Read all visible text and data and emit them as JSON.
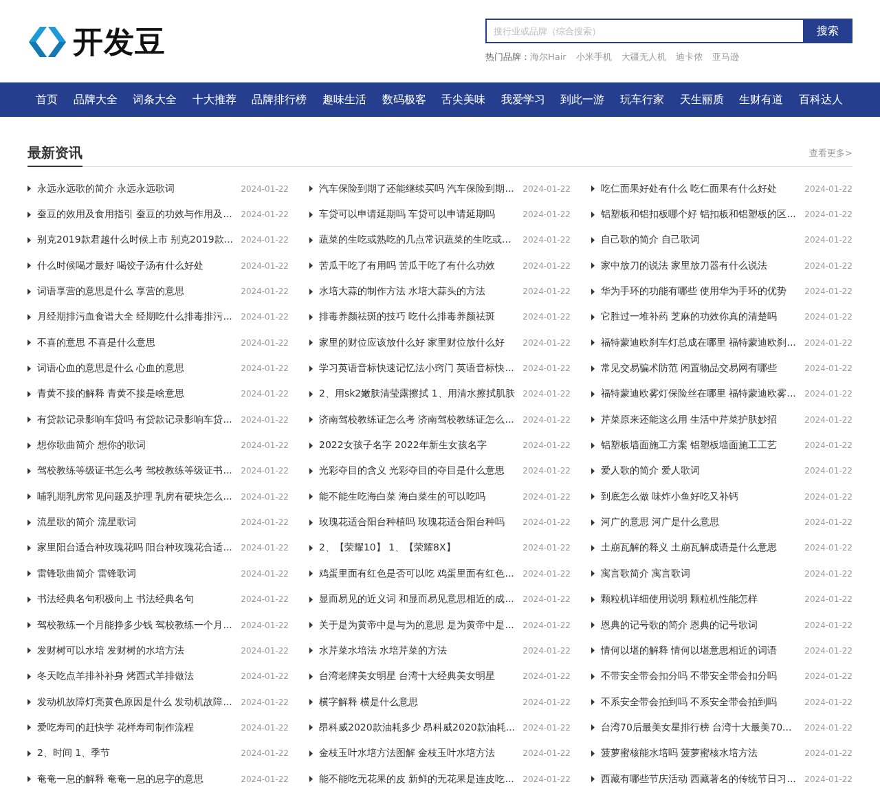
{
  "header": {
    "logo_text": "开发豆",
    "search": {
      "placeholder": "搜行业或品牌（综合搜索）",
      "button": "搜索"
    },
    "hot_label": "热门品牌：",
    "hot_brands": [
      "海尔Hair",
      "小米手机",
      "大疆无人机",
      "迪卡侬",
      "亚马逊"
    ]
  },
  "nav": [
    "首页",
    "品牌大全",
    "词条大全",
    "十大推荐",
    "品牌排行榜",
    "趣味生活",
    "数码极客",
    "舌尖美味",
    "我爱学习",
    "到此一游",
    "玩车行家",
    "天生丽质",
    "生财有道",
    "百科达人"
  ],
  "news": {
    "title": "最新资讯",
    "more": "查看更多>",
    "columns": [
      [
        {
          "title": "永远永远歌的简介 永远永远歌词",
          "date": "2024-01-22"
        },
        {
          "title": "蚕豆的效用及食用指引 蚕豆的功效与作用及...",
          "date": "2024-01-22"
        },
        {
          "title": "别克2019款君越什么时候上市 别克2019款...",
          "date": "2024-01-22"
        },
        {
          "title": "什么时候喝才最好 喝饺子汤有什么好处",
          "date": "2024-01-22"
        },
        {
          "title": "词语享营的意思是什么 享营的意思",
          "date": "2024-01-22"
        },
        {
          "title": "月经期排污血食谱大全 经期吃什么排毒排污...",
          "date": "2024-01-22"
        },
        {
          "title": "不喜的意思 不喜是什么意思",
          "date": "2024-01-22"
        },
        {
          "title": "词语心血的意思是什么 心血的意思",
          "date": "2024-01-22"
        },
        {
          "title": "青黄不接的解释 青黄不接是啥意思",
          "date": "2024-01-22"
        },
        {
          "title": "有贷款记录影响车贷吗 有贷款记录影响车贷...",
          "date": "2024-01-22"
        },
        {
          "title": "想你歌曲简介 想你的歌词",
          "date": "2024-01-22"
        },
        {
          "title": "驾校教练等级证书怎么考 驾校教练等级证书...",
          "date": "2024-01-22"
        },
        {
          "title": "哺乳期乳房常见问题及护理 乳房有硬块怎么...",
          "date": "2024-01-22"
        },
        {
          "title": "流星歌的简介 流星歌词",
          "date": "2024-01-22"
        },
        {
          "title": "家里阳台适合种玫瑰花吗 阳台种玫瑰花合适...",
          "date": "2024-01-22"
        },
        {
          "title": "雷锋歌曲简介 雷锋歌词",
          "date": "2024-01-22"
        },
        {
          "title": "书法经典名句积极向上 书法经典名句",
          "date": "2024-01-22"
        },
        {
          "title": "驾校教练一个月能挣多少钱 驾校教练一个月...",
          "date": "2024-01-22"
        },
        {
          "title": "发财树可以水培 发财树的水培方法",
          "date": "2024-01-22"
        },
        {
          "title": "冬天吃点羊排补补身 烤西式羊排做法",
          "date": "2024-01-22"
        },
        {
          "title": "发动机故障灯亮黄色原因是什么 发动机故障...",
          "date": "2024-01-22"
        },
        {
          "title": "爱吃寿司的赶快学 花样寿司制作流程",
          "date": "2024-01-22"
        },
        {
          "title": "2、时间 1、季节",
          "date": "2024-01-22"
        },
        {
          "title": "奄奄一息的解释 奄奄一息的息字的意思",
          "date": "2024-01-22"
        }
      ],
      [
        {
          "title": "汽车保险到期了还能继续买吗 汽车保险到期...",
          "date": "2024-01-22"
        },
        {
          "title": "车贷可以申请延期吗 车贷可以申请延期吗",
          "date": "2024-01-22"
        },
        {
          "title": "蔬菜的生吃或熟吃的几点常识蔬菜的生吃或...",
          "date": "2024-01-22"
        },
        {
          "title": "苦瓜干吃了有用吗 苦瓜干吃了有什么功效",
          "date": "2024-01-22"
        },
        {
          "title": "水培大蒜的制作方法 水培大蒜头的方法",
          "date": "2024-01-22"
        },
        {
          "title": "排毒养颜祛斑的技巧 吃什么排毒养颜祛斑",
          "date": "2024-01-22"
        },
        {
          "title": "家里的财位应该放什么好 家里财位放什么好",
          "date": "2024-01-22"
        },
        {
          "title": "学习英语音标快速记忆法小窍门 英语音标快...",
          "date": "2024-01-22"
        },
        {
          "title": "2、用sk2嫩肤清莹露擦拭 1、用清水擦拭肌肤",
          "date": "2024-01-22"
        },
        {
          "title": "济南驾校教练证怎么考 济南驾校教练证怎么...",
          "date": "2024-01-22"
        },
        {
          "title": "2022女孩子名字 2022年新生女孩名字",
          "date": "2024-01-22"
        },
        {
          "title": "光彩夺目的含义 光彩夺目的夺目是什么意思",
          "date": "2024-01-22"
        },
        {
          "title": "能不能生吃海白菜 海白菜生的可以吃吗",
          "date": "2024-01-22"
        },
        {
          "title": "玫瑰花适合阳台种植吗 玫瑰花适合阳台种吗",
          "date": "2024-01-22"
        },
        {
          "title": "2、【荣耀10】 1、【荣耀8X】",
          "date": "2024-01-22"
        },
        {
          "title": "鸡蛋里面有红色是否可以吃 鸡蛋里面有红色...",
          "date": "2024-01-22"
        },
        {
          "title": "显而易见的近义词 和显而易见意思相近的成...",
          "date": "2024-01-22"
        },
        {
          "title": "关于是为黄帝中是与为的意思 是为黄帝中是...",
          "date": "2024-01-22"
        },
        {
          "title": "水芹菜水培法 水培芹菜的方法",
          "date": "2024-01-22"
        },
        {
          "title": "台湾老牌美女明星 台湾十大经典美女明星",
          "date": "2024-01-22"
        },
        {
          "title": "横字解释 横是什么意思",
          "date": "2024-01-22"
        },
        {
          "title": "昂科威2020款油耗多少 昂科威2020款油耗...",
          "date": "2024-01-22"
        },
        {
          "title": "金枝玉叶水培方法图解 金枝玉叶水培方法",
          "date": "2024-01-22"
        },
        {
          "title": "能不能吃无花果的皮 新鲜的无花果是连皮吃...",
          "date": "2024-01-22"
        }
      ],
      [
        {
          "title": "吃仁面果好处有什么 吃仁面果有什么好处",
          "date": "2024-01-22"
        },
        {
          "title": "铝塑板和铝扣板哪个好 铝扣板和铝塑板的区...",
          "date": "2024-01-22"
        },
        {
          "title": "自己歌的简介 自己歌词",
          "date": "2024-01-22"
        },
        {
          "title": "家中放刀的说法 家里放刀器有什么说法",
          "date": "2024-01-22"
        },
        {
          "title": "华为手环的功能有哪些 使用华为手环的优势",
          "date": "2024-01-22"
        },
        {
          "title": "它胜过一堆补药 芝麻的功效你真的清楚吗",
          "date": "2024-01-22"
        },
        {
          "title": "福特蒙迪欧刹车灯总成在哪里 福特蒙迪欧刹...",
          "date": "2024-01-22"
        },
        {
          "title": "常见交易骗术防范 闲置物品交易网有哪些",
          "date": "2024-01-22"
        },
        {
          "title": "福特蒙迪欧雾灯保险丝在哪里 福特蒙迪欧雾...",
          "date": "2024-01-22"
        },
        {
          "title": "芹菜原来还能这么用 生活中芹菜护肤妙招",
          "date": "2024-01-22"
        },
        {
          "title": "铝塑板墙面施工方案 铝塑板墙面施工工艺",
          "date": "2024-01-22"
        },
        {
          "title": "爱人歌的简介 爱人歌词",
          "date": "2024-01-22"
        },
        {
          "title": "到底怎么做 味炸小鱼好吃又补钙",
          "date": "2024-01-22"
        },
        {
          "title": "河广的意思 河广是什么意思",
          "date": "2024-01-22"
        },
        {
          "title": "土崩瓦解的释义 土崩瓦解成语是什么意思",
          "date": "2024-01-22"
        },
        {
          "title": "寓言歌简介 寓言歌词",
          "date": "2024-01-22"
        },
        {
          "title": "颗粒机详细使用说明 颗粒机性能怎样",
          "date": "2024-01-22"
        },
        {
          "title": "恩典的记号歌的简介 恩典的记号歌词",
          "date": "2024-01-22"
        },
        {
          "title": "情何以堪的解释 情何以堪意思相近的词语",
          "date": "2024-01-22"
        },
        {
          "title": "不带安全带会扣分吗 不带安全带会扣分吗",
          "date": "2024-01-22"
        },
        {
          "title": "不系安全带会拍到吗 不系安全带会拍到吗",
          "date": "2024-01-22"
        },
        {
          "title": "台湾70后最美女星排行榜 台湾十大最美70...",
          "date": "2024-01-22"
        },
        {
          "title": "菠萝蜜核能水培吗 菠萝蜜核水培方法",
          "date": "2024-01-22"
        },
        {
          "title": "西藏有哪些节庆活动 西藏著名的传统节日习...",
          "date": "2024-01-22"
        }
      ]
    ]
  }
}
